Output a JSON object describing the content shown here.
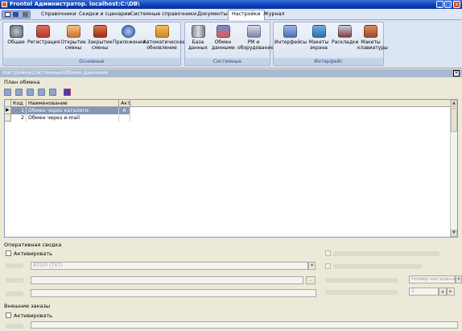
{
  "window": {
    "title": "Frontol Администратор. localhost:C:\\DB\\",
    "controls": [
      "minimize",
      "maximize",
      "close"
    ]
  },
  "menu": {
    "items": [
      "Справочники",
      "Скидки и сценарии",
      "Системные справочники",
      "Документы",
      "Настройки",
      "Журнал"
    ],
    "active": "Настройки"
  },
  "ribbon": {
    "groups": [
      {
        "label": "Основные",
        "buttons": [
          {
            "label": "Общее",
            "icon": "gears-icon"
          },
          {
            "label": "Регистрация",
            "icon": "register-icon"
          },
          {
            "label": "Открытие смены",
            "icon": "shift-open-icon"
          },
          {
            "label": "Закрытие смены",
            "icon": "shift-close-icon"
          },
          {
            "label": "Приложения",
            "icon": "apps-icon"
          },
          {
            "label": "Автоматическое обновление",
            "icon": "auto-update-icon"
          }
        ]
      },
      {
        "label": "Системные",
        "buttons": [
          {
            "label": "База данных",
            "icon": "database-icon"
          },
          {
            "label": "Обмен данными",
            "icon": "data-exchange-icon"
          },
          {
            "label": "РМ и оборудование",
            "icon": "equipment-icon"
          }
        ]
      },
      {
        "label": "Интерфейс",
        "buttons": [
          {
            "label": "Интерфейсы",
            "icon": "interfaces-icon"
          },
          {
            "label": "Макеты экрана",
            "icon": "screen-layout-icon"
          },
          {
            "label": "Раскладки",
            "icon": "keyboard-layout-icon"
          },
          {
            "label": "Макеты клавиатуры",
            "icon": "keyboard-icon"
          }
        ]
      }
    ]
  },
  "breadcrumb": "Настройки\\Системные\\Обмен данными",
  "exchange_plan": {
    "title": "План обмена",
    "columns": [
      "Код",
      "Наименование",
      "Акт."
    ],
    "rows": [
      {
        "code": "1",
        "name": "Обмен через каталоги",
        "active": "А",
        "selected": true
      },
      {
        "code": "2",
        "name": "Обмен через e-mail",
        "active": "",
        "selected": false
      }
    ]
  },
  "operative_summary": {
    "title": "Оперативная сводка",
    "activate_label": "Активировать",
    "driver_value": "АТОЛ (TXT)",
    "store_field_placeholder": "Номер магазина",
    "counter_value": "1"
  },
  "external_orders": {
    "title": "Внешние заказы",
    "activate_label": "Активировать"
  },
  "colors": {
    "selection": "#8696b9",
    "title_bar": "#0a3fb5",
    "breadcrumb": "#a9b8d3"
  }
}
